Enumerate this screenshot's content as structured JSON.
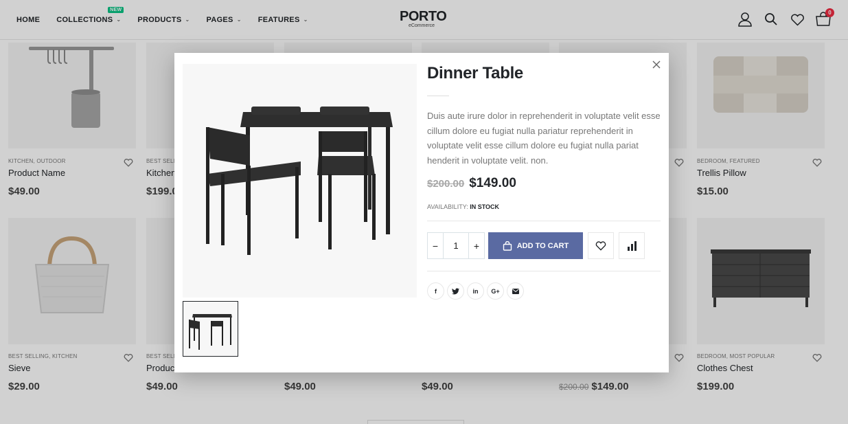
{
  "header": {
    "nav": [
      {
        "label": "Home",
        "chevron": false
      },
      {
        "label": "Collections",
        "chevron": true,
        "badge": "NEW"
      },
      {
        "label": "Products",
        "chevron": true
      },
      {
        "label": "Pages",
        "chevron": true
      },
      {
        "label": "Features",
        "chevron": true
      }
    ],
    "logo_main": "PORTO",
    "logo_sub": "eCommerce",
    "cart_count": "0",
    "icons": [
      "user-icon",
      "search-icon",
      "wishlist-icon",
      "cart-icon"
    ]
  },
  "products": [
    {
      "category": "KITCHEN, OUTDOOR",
      "name": "Product Name",
      "price": "$49.00"
    },
    {
      "category": "BEST SELLI",
      "name": "Kitchen",
      "price": "$199.0"
    },
    {
      "category": "BEDROOM, FEATURED",
      "name": "Trellis Pillow",
      "price": "$15.00"
    },
    {
      "category": "BEST SELLING, KITCHEN",
      "name": "Sieve",
      "price": "$29.00"
    },
    {
      "category": "BEST SELLI",
      "name": "Produc",
      "price": "$49.00"
    },
    {
      "price": "$49.00"
    },
    {
      "price": "$49.00"
    },
    {
      "old_price": "$200.00",
      "price": "$149.00"
    },
    {
      "category": "BEDROOM, MOST POPULAR",
      "name": "Clothes Chest",
      "price": "$199.00"
    }
  ],
  "modal": {
    "title": "Dinner Table",
    "description": "Duis aute irure dolor in reprehenderit in voluptate velit esse cillum dolore eu fugiat nulla pariatur reprehenderit in voluptate velit esse cillum dolore eu fugiat nulla pariat henderit in voluptate velit. non.",
    "old_price": "$200.00",
    "price": "$149.00",
    "availability_label": "AVAILABILITY:",
    "availability_value": "IN STOCK",
    "quantity": "1",
    "add_to_cart_label": "ADD TO CART",
    "social": [
      "f",
      "t",
      "in",
      "G+",
      "mail"
    ],
    "colors": {
      "accent": "#5a6aa2",
      "text": "#222529",
      "muted": "#777777"
    }
  }
}
